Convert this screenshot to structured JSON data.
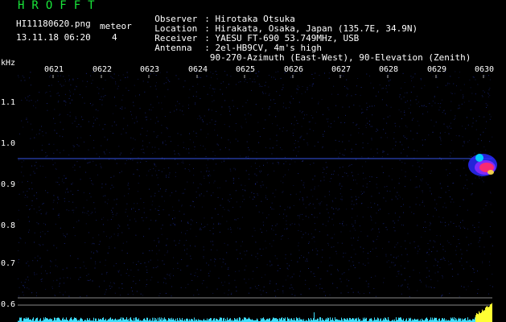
{
  "header": {
    "app_title": "HROFFT",
    "filename": "HI11180620.png",
    "datetime": "13.11.18 06:20",
    "meteor_label": "meteor",
    "meteor_count": "4"
  },
  "info": [
    {
      "key": "Observer",
      "sep": ":",
      "value": "Hirotaka Otsuka"
    },
    {
      "key": "Location",
      "sep": ":",
      "value": "Hirakata, Osaka, Japan (135.7E, 34.9N)"
    },
    {
      "key": "Receiver",
      "sep": ":",
      "value": "YAESU FT-690 53.749MHz, USB"
    },
    {
      "key": "Antenna",
      "sep": ":",
      "value": "2el-HB9CV, 4m's high"
    },
    {
      "key": "",
      "sep": "",
      "value": "90-270-Azimuth (East-West), 90-Elevation (Zenith)"
    }
  ],
  "axis": {
    "y_unit": "kHz",
    "y_ticks": [
      "1.1",
      "1.0",
      "0.9",
      "0.8",
      "0.7",
      "0.6"
    ],
    "x_ticks": [
      "0621",
      "0622",
      "0623",
      "0624",
      "0625",
      "0626",
      "0627",
      "0628",
      "0629",
      "0630"
    ]
  },
  "colors": {
    "background": "#000000",
    "title_green": "#19e63a",
    "noise_blue": "#1c2a8c",
    "carrier": "#3a5cff",
    "burst_hot": "#ff2a6a",
    "histogram": "#3fe0ff",
    "histogram_hot": "#ffff33"
  }
}
